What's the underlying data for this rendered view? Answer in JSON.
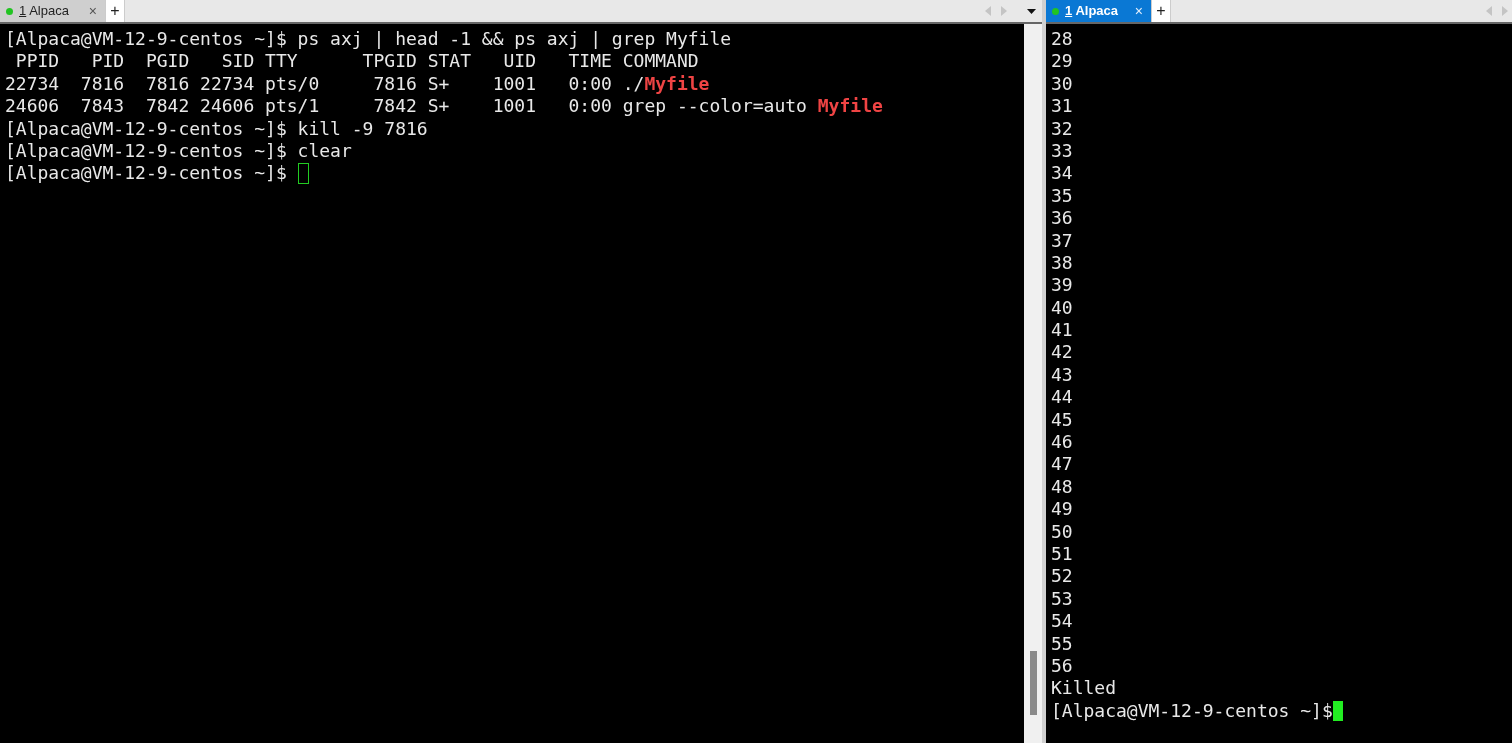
{
  "panes": [
    {
      "tab": {
        "number": "1",
        "name": "Alpaca",
        "close": "×",
        "selected": false
      },
      "new_tab": "+",
      "focused": false,
      "scrollbar": true,
      "lines": [
        [
          {
            "kind": "plain",
            "text": "[Alpaca@VM-12-9-centos ~]$ ps axj | head -1 && ps axj | grep Myfile"
          }
        ],
        [
          {
            "kind": "plain",
            "text": " PPID   PID  PGID   SID TTY      TPGID STAT   UID   TIME COMMAND"
          }
        ],
        [
          {
            "kind": "plain",
            "text": "22734  7816  7816 22734 pts/0     7816 S+    1001   0:00 ./"
          },
          {
            "kind": "match",
            "text": "Myfile"
          }
        ],
        [
          {
            "kind": "plain",
            "text": "24606  7843  7842 24606 pts/1     7842 S+    1001   0:00 grep --color=auto "
          },
          {
            "kind": "match",
            "text": "Myfile"
          }
        ],
        [
          {
            "kind": "plain",
            "text": "[Alpaca@VM-12-9-centos ~]$ kill -9 7816"
          }
        ],
        [
          {
            "kind": "plain",
            "text": "[Alpaca@VM-12-9-centos ~]$ clear"
          }
        ],
        [
          {
            "kind": "prompt",
            "text": "[Alpaca@VM-12-9-centos ~]$ "
          },
          {
            "kind": "cursor"
          }
        ]
      ]
    },
    {
      "tab": {
        "number": "1",
        "name": "Alpaca",
        "close": "×",
        "selected": true
      },
      "new_tab": "+",
      "focused": true,
      "scrollbar": false,
      "lines": [
        [
          {
            "kind": "plain",
            "text": "28"
          }
        ],
        [
          {
            "kind": "plain",
            "text": "29"
          }
        ],
        [
          {
            "kind": "plain",
            "text": "30"
          }
        ],
        [
          {
            "kind": "plain",
            "text": "31"
          }
        ],
        [
          {
            "kind": "plain",
            "text": "32"
          }
        ],
        [
          {
            "kind": "plain",
            "text": "33"
          }
        ],
        [
          {
            "kind": "plain",
            "text": "34"
          }
        ],
        [
          {
            "kind": "plain",
            "text": "35"
          }
        ],
        [
          {
            "kind": "plain",
            "text": "36"
          }
        ],
        [
          {
            "kind": "plain",
            "text": "37"
          }
        ],
        [
          {
            "kind": "plain",
            "text": "38"
          }
        ],
        [
          {
            "kind": "plain",
            "text": "39"
          }
        ],
        [
          {
            "kind": "plain",
            "text": "40"
          }
        ],
        [
          {
            "kind": "plain",
            "text": "41"
          }
        ],
        [
          {
            "kind": "plain",
            "text": "42"
          }
        ],
        [
          {
            "kind": "plain",
            "text": "43"
          }
        ],
        [
          {
            "kind": "plain",
            "text": "44"
          }
        ],
        [
          {
            "kind": "plain",
            "text": "45"
          }
        ],
        [
          {
            "kind": "plain",
            "text": "46"
          }
        ],
        [
          {
            "kind": "plain",
            "text": "47"
          }
        ],
        [
          {
            "kind": "plain",
            "text": "48"
          }
        ],
        [
          {
            "kind": "plain",
            "text": "49"
          }
        ],
        [
          {
            "kind": "plain",
            "text": "50"
          }
        ],
        [
          {
            "kind": "plain",
            "text": "51"
          }
        ],
        [
          {
            "kind": "plain",
            "text": "52"
          }
        ],
        [
          {
            "kind": "plain",
            "text": "53"
          }
        ],
        [
          {
            "kind": "plain",
            "text": "54"
          }
        ],
        [
          {
            "kind": "plain",
            "text": "55"
          }
        ],
        [
          {
            "kind": "plain",
            "text": "56"
          }
        ],
        [
          {
            "kind": "plain",
            "text": "Killed"
          }
        ],
        [
          {
            "kind": "prompt",
            "text": "[Alpaca@VM-12-9-centos ~]$"
          },
          {
            "kind": "cursor"
          }
        ]
      ]
    }
  ]
}
